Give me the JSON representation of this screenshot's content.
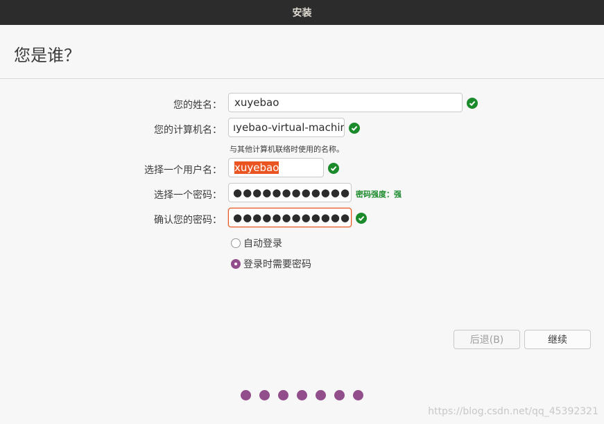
{
  "window": {
    "title": "安装"
  },
  "page": {
    "title": "您是谁？"
  },
  "form": {
    "name_label": "您的姓名：",
    "name_value": "xuyebao",
    "computer_label": "您的计算机名：",
    "computer_value": "ıyebao-virtual-machine",
    "computer_hint": "与其他计算机联络时使用的名称。",
    "username_label": "选择一个用户名：",
    "username_value": "xuyebao",
    "password_label": "选择一个密码：",
    "password_value": "●●●●●●●●●●●●",
    "password_strength": "密码强度：强",
    "confirm_label": "确认您的密码：",
    "confirm_value": "●●●●●●●●●●●●"
  },
  "login_options": {
    "auto_login": "自动登录",
    "require_password": "登录时需要密码",
    "selected": "require_password"
  },
  "buttons": {
    "back": "后退(B)",
    "continue": "继续"
  },
  "watermark": "https://blog.csdn.net/qq_45392321",
  "colors": {
    "accent": "#e95420",
    "progress": "#924d8b",
    "valid": "#1b8a2b"
  },
  "progress_steps": 7
}
